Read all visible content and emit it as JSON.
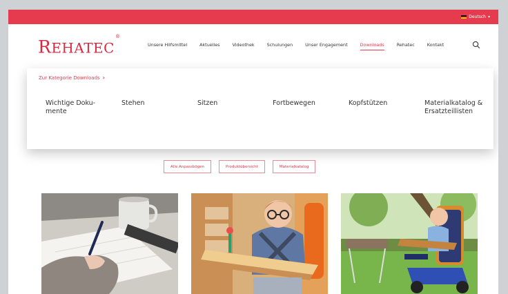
{
  "header": {
    "language": "Deutsch",
    "logo": {
      "big_r": "R",
      "rest": "EHATEC",
      "reg": "®"
    },
    "nav": [
      {
        "label": "Unsere Hilfsmittel"
      },
      {
        "label": "Aktuelles"
      },
      {
        "label": "Videothek"
      },
      {
        "label": "Schulungen"
      },
      {
        "label": "Unser Engagement"
      },
      {
        "label": "Downloads",
        "active": true
      },
      {
        "label": "Rehatec"
      },
      {
        "label": "Kontakt"
      }
    ]
  },
  "mega_menu": {
    "category_link": "Zur Kategorie Downloads",
    "items": [
      {
        "label": "Wichtige Doku-\nmente"
      },
      {
        "label": "Stehen"
      },
      {
        "label": "Sitzen"
      },
      {
        "label": "Fortbewegen"
      },
      {
        "label": "Kopfstützen"
      },
      {
        "label": "Materialkatalog &\nErsatzteillisten"
      }
    ]
  },
  "filters": [
    "Alle Anpassbögen",
    "Produktübersicht",
    "Materialkatalog"
  ],
  "colors": {
    "brand": "#e63a4e",
    "logo": "#d82a3f"
  },
  "icons": {
    "search": "search-icon",
    "language_caret": "chevron-down-icon"
  }
}
